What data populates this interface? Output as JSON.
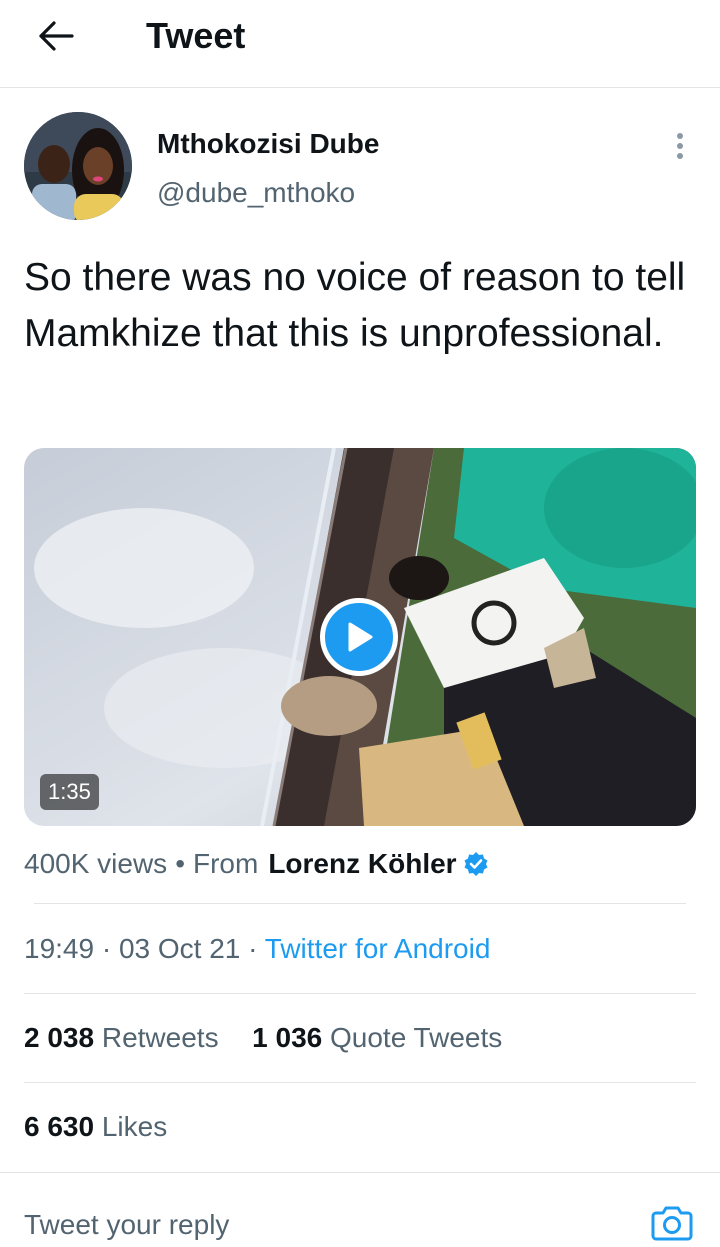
{
  "header": {
    "title": "Tweet",
    "back_icon": "arrow-left-icon"
  },
  "author": {
    "display_name": "Mthokozisi Dube",
    "handle": "@dube_mthoko",
    "more_icon": "more-vertical-icon"
  },
  "tweet": {
    "text": "So there was no voice of reason to tell Mamkhize that this is unprofessional."
  },
  "media": {
    "type": "video",
    "duration": "1:35",
    "play_icon": "play-icon"
  },
  "video_info": {
    "views": "400K views",
    "separator": "•",
    "from_label": "From",
    "from_name": "Lorenz Köhler",
    "verified_icon": "verified-badge-icon"
  },
  "meta": {
    "time": "19:49",
    "date": "03 Oct 21",
    "dot": "·",
    "client": "Twitter for Android"
  },
  "stats": {
    "retweets_count": "2 038",
    "retweets_label": "Retweets",
    "quotes_count": "1 036",
    "quotes_label": "Quote Tweets",
    "likes_count": "6 630",
    "likes_label": "Likes"
  },
  "reply": {
    "placeholder": "Tweet your reply",
    "camera_icon": "camera-icon"
  },
  "colors": {
    "accent": "#1d9bf0",
    "text_primary": "#0f1419",
    "text_secondary": "#536471",
    "divider": "#e1e5e8"
  }
}
